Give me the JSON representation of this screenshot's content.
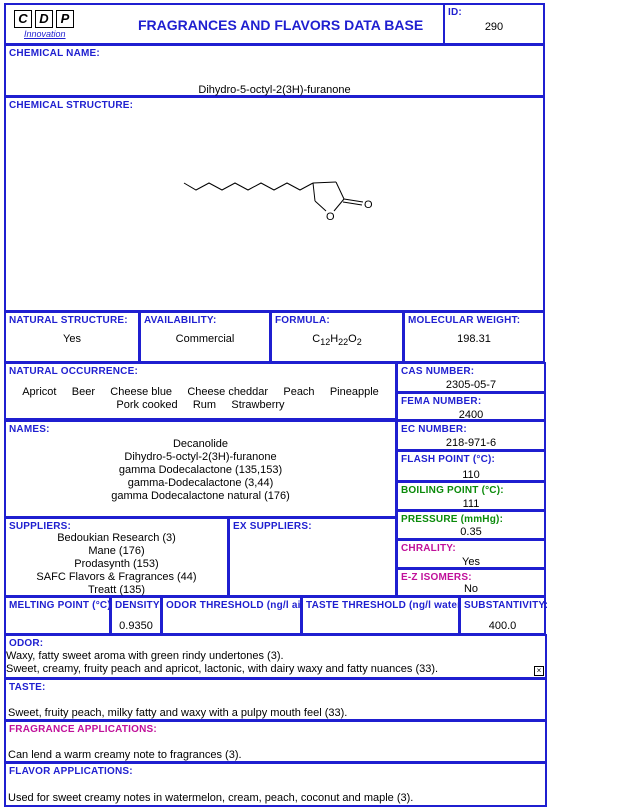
{
  "header": {
    "logo_letters": [
      "C",
      "D",
      "P"
    ],
    "logo_sub": "Innovation",
    "title": "FRAGRANCES AND FLAVORS DATA BASE",
    "id_label": "ID:",
    "id_value": "290"
  },
  "chemical_name": {
    "label": "CHEMICAL NAME:",
    "value": "Dihydro-5-octyl-2(3H)-furanone"
  },
  "chemical_structure": {
    "label": "CHEMICAL STRUCTURE:",
    "atom_labels": [
      "O",
      "O"
    ]
  },
  "natural_structure": {
    "label": "NATURAL STRUCTURE:",
    "value": "Yes"
  },
  "availability": {
    "label": "AVAILABILITY:",
    "value": "Commercial"
  },
  "formula": {
    "label": "FORMULA:",
    "parts": [
      "C",
      "12",
      "H",
      "22",
      "O",
      "2"
    ]
  },
  "molecular_weight": {
    "label": "MOLECULAR WEIGHT:",
    "value": "198.31"
  },
  "natural_occurrence": {
    "label": "NATURAL OCCURRENCE:",
    "row1": [
      "Apricot",
      "Beer",
      "Cheese blue",
      "Cheese cheddar",
      "Peach",
      "Pineapple"
    ],
    "row2": [
      "Pork cooked",
      "Rum",
      "Strawberry"
    ]
  },
  "cas": {
    "label": "CAS NUMBER:",
    "value": "2305-05-7"
  },
  "fema": {
    "label": "FEMA NUMBER:",
    "value": "2400"
  },
  "names": {
    "label": "NAMES:",
    "items": [
      "Decanolide",
      "Dihydro-5-octyl-2(3H)-furanone",
      "gamma Dodecalactone (135,153)",
      "gamma-Dodecalactone (3,44)",
      "gamma Dodecalactone natural (176)"
    ]
  },
  "ec": {
    "label": "EC NUMBER:",
    "value": "218-971-6"
  },
  "flash_point": {
    "label": "FLASH POINT (°C):",
    "value": "110"
  },
  "boiling_point": {
    "label": "BOILING POINT (°C):",
    "value": "111"
  },
  "pressure": {
    "label": "PRESSURE (mmHg):",
    "value": "0.35"
  },
  "chirality": {
    "label": "CHRALITY:",
    "value": "Yes"
  },
  "ez_isomers": {
    "label": "E-Z ISOMERS:",
    "value": "No"
  },
  "suppliers": {
    "label": "SUPPLIERS:",
    "items": [
      "Bedoukian Research (3)",
      "Mane (176)",
      "Prodasynth (153)",
      "SAFC Flavors & Fragrances (44)",
      "Treatt (135)"
    ]
  },
  "ex_suppliers": {
    "label": "EX SUPPLIERS:"
  },
  "melting_point": {
    "label": "MELTING POINT (°C):",
    "value": ""
  },
  "density": {
    "label": "DENSITY",
    "value": "0.9350"
  },
  "odor_threshold": {
    "label": "ODOR THRESHOLD (ng/l air",
    "value": ""
  },
  "taste_threshold": {
    "label": "TASTE THRESHOLD (ng/l water)",
    "value": ""
  },
  "substantivity": {
    "label": "SUBSTANTIVITY:",
    "value": "400.0"
  },
  "odor": {
    "label": "ODOR:",
    "lines": [
      "Waxy, fatty sweet aroma with green rindy undertones (3).",
      "Sweet, creamy, fruity peach and apricot, lactonic, with dairy waxy and fatty nuances (33)."
    ]
  },
  "taste": {
    "label": "TASTE:",
    "text": "Sweet, fruity peach, milky fatty and waxy with a pulpy mouth feel (33)."
  },
  "fragrance_applications": {
    "label": "FRAGRANCE APPLICATIONS:",
    "text": "Can lend a warm creamy note to fragrances (3)."
  },
  "flavor_applications": {
    "label": "FLAVOR APPLICATIONS:",
    "text": "Used for sweet creamy notes in watermelon, cream, peach, coconut and maple (3)."
  }
}
